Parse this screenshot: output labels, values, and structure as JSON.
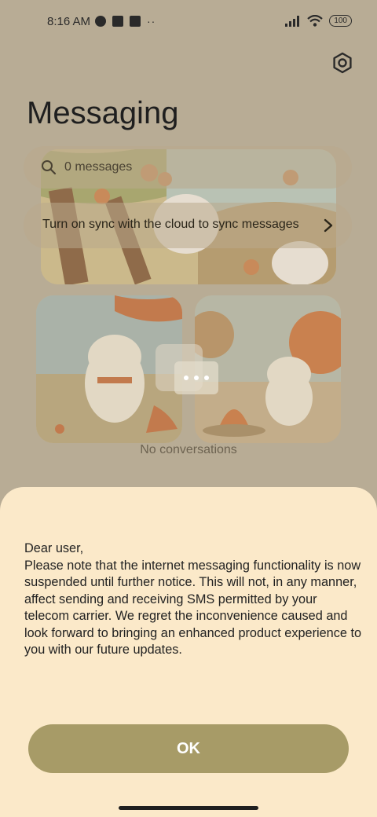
{
  "status_bar": {
    "time": "8:16 AM",
    "battery": "100",
    "more": "··"
  },
  "header": {
    "title": "Messaging"
  },
  "search": {
    "placeholder": "0 messages"
  },
  "sync_banner": {
    "text": "Turn on sync with the cloud to sync messages"
  },
  "empty_state": {
    "text": "No conversations"
  },
  "dialog": {
    "greeting": "Dear user,",
    "body": "Please note that the internet messaging functionality is now suspended until further notice. This will not, in any manner, affect sending and receiving SMS permitted by your telecom carrier. We regret the inconvenience caused and look forward to bringing an enhanced product experience to you with our future updates.",
    "ok_label": "OK"
  },
  "colors": {
    "accent": "#a79b67",
    "sheet_bg": "#fbe9c9",
    "scrim_bg": "#b8ac95"
  }
}
